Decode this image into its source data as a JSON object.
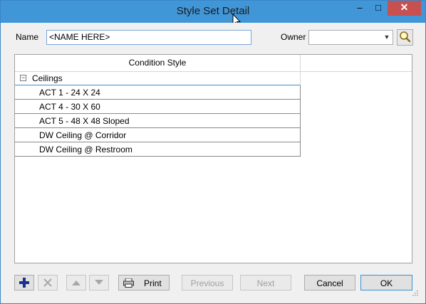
{
  "window": {
    "title": "Style Set Detail",
    "minimize_glyph": "‒",
    "maximize_glyph": "□",
    "close_glyph": "✕"
  },
  "form": {
    "name_label": "Name",
    "name_value": "<NAME HERE>",
    "owner_label": "Owner",
    "owner_value": ""
  },
  "grid": {
    "column_header": "Condition Style",
    "group_label": "Ceilings",
    "group_expander": "−",
    "rows": [
      "ACT 1 - 24 X 24",
      "ACT 4 - 30 X 60",
      "ACT 5 - 48 X 48 Sloped",
      "DW Ceiling @ Corridor",
      "DW Ceiling @ Restroom"
    ]
  },
  "toolbar": {
    "add_icon": "plus-icon",
    "delete_icon": "x-icon",
    "up_icon": "arrow-up-icon",
    "down_icon": "arrow-down-icon",
    "print_label": "Print",
    "previous_label": "Previous",
    "next_label": "Next",
    "cancel_label": "Cancel",
    "ok_label": "OK"
  },
  "colors": {
    "titlebar": "#4196d8",
    "close": "#c75050",
    "accent": "#3c8fd0",
    "add_icon": "#1c2f8a"
  }
}
